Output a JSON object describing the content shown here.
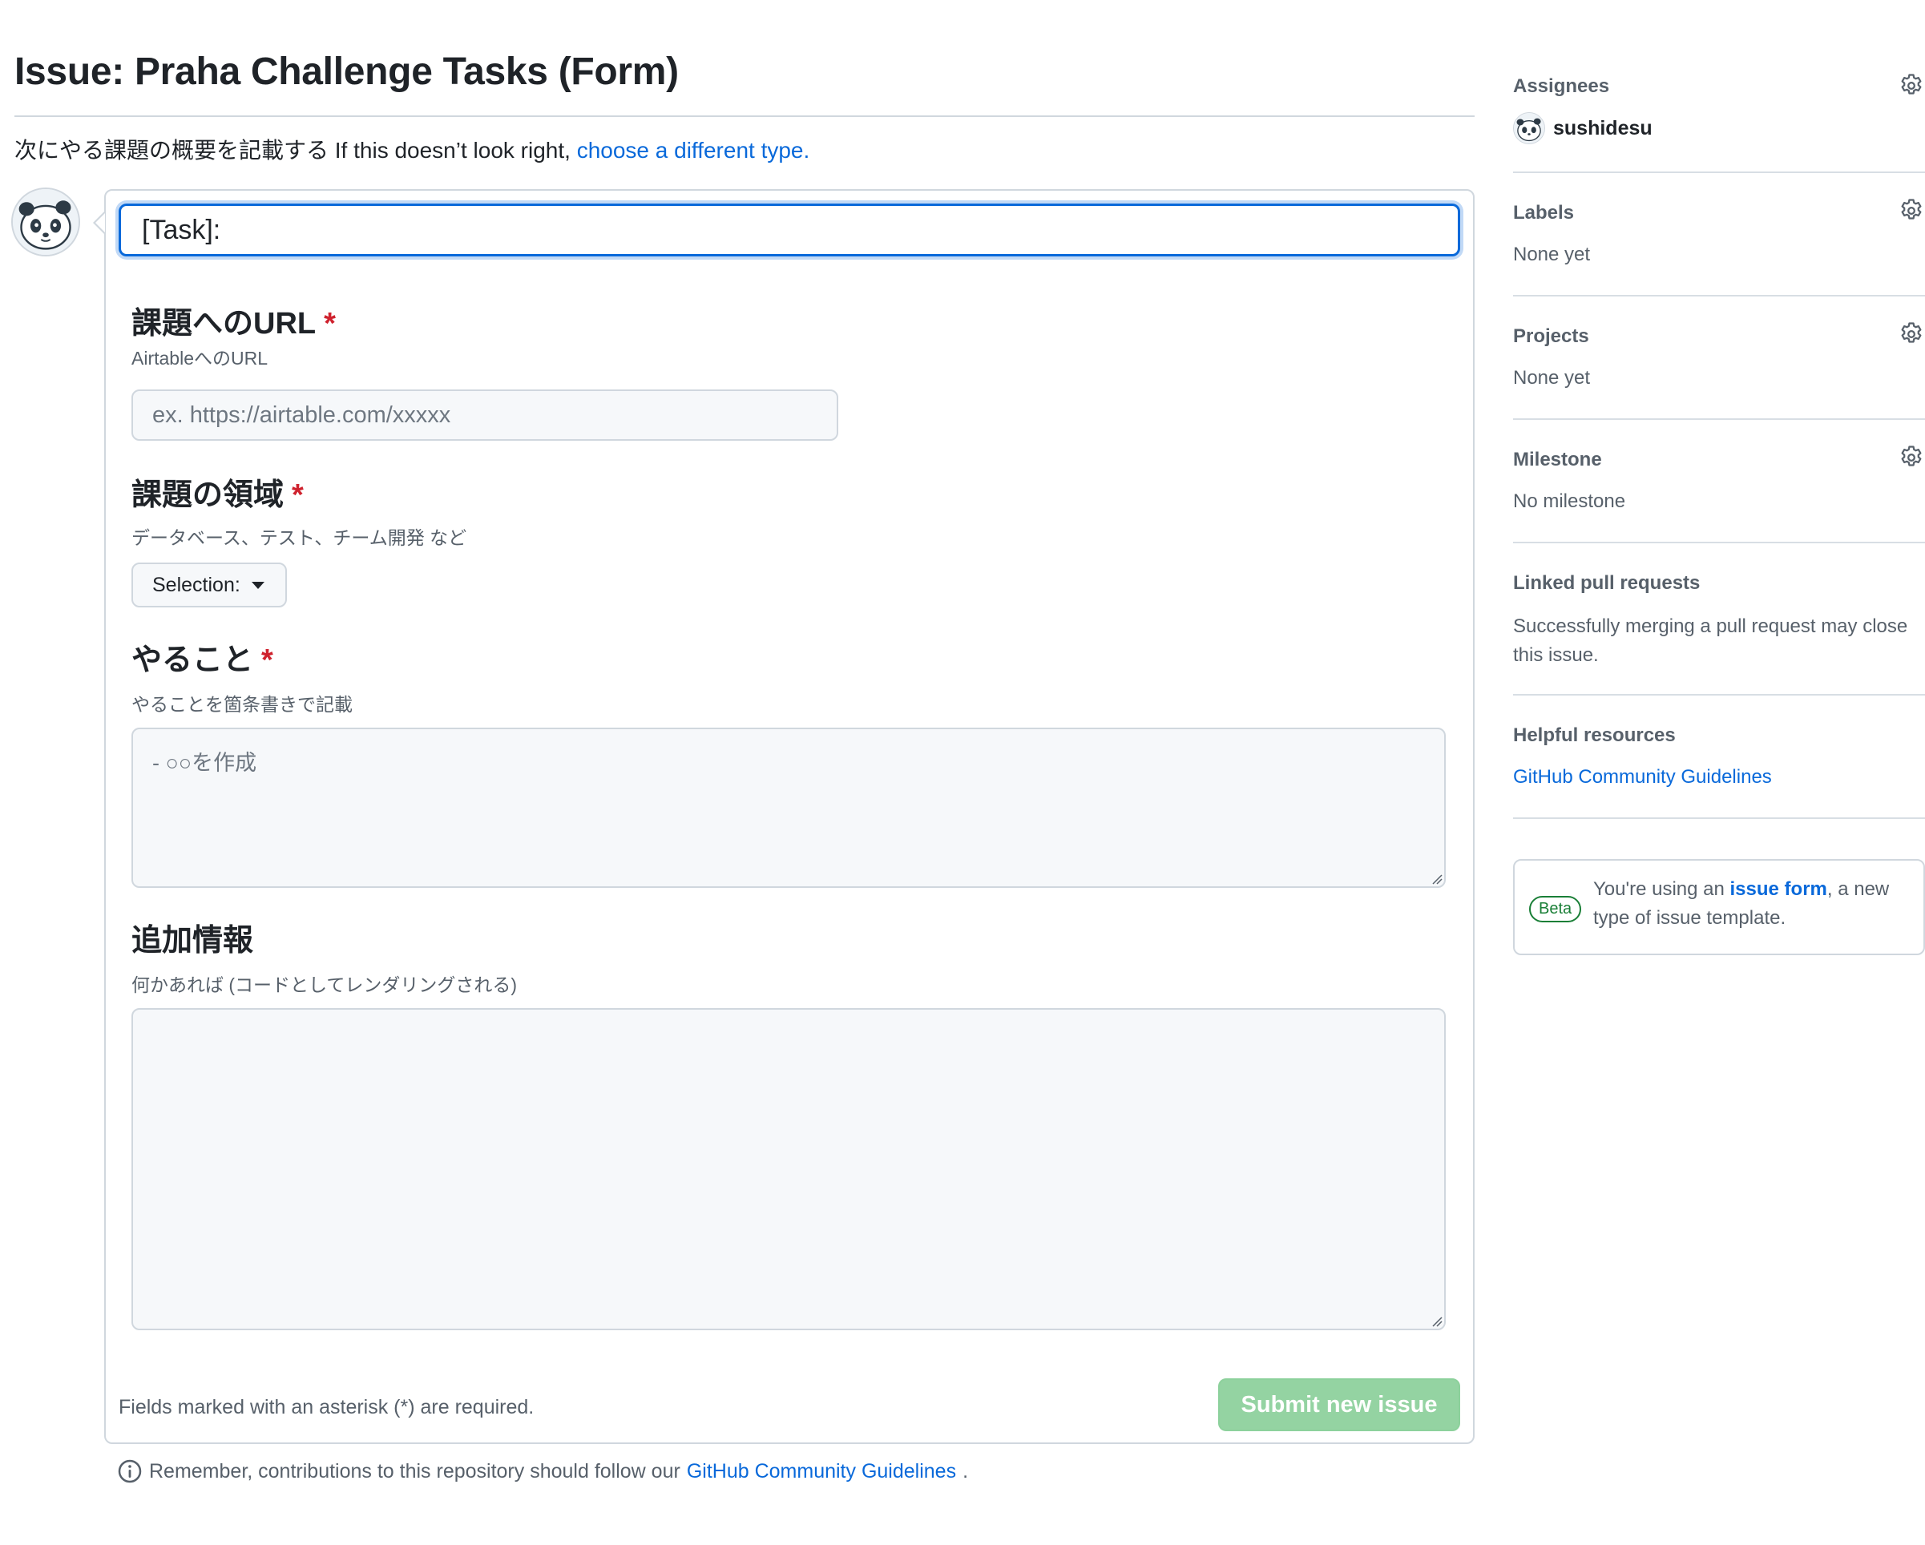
{
  "page": {
    "title": "Issue: Praha Challenge Tasks (Form)",
    "intro_text": "次にやる課題の概要を記載する If this doesn’t look right,",
    "intro_link": "choose a different type."
  },
  "form": {
    "title_value": "[Task]: ",
    "fields": [
      {
        "label": "課題へのURL",
        "required_mark": "*",
        "description": "AirtableへのURL",
        "placeholder": "ex. https://airtable.com/xxxxx"
      },
      {
        "label": "課題の領域",
        "required_mark": "*",
        "description": "データベース、テスト、チーム開発 など",
        "select_label": "Selection:"
      },
      {
        "label": "やること",
        "required_mark": "*",
        "description": "やることを箇条書きで記載",
        "placeholder": "- ○○を作成"
      },
      {
        "label": "追加情報",
        "description": "何かあれば (コードとしてレンダリングされる)",
        "placeholder": ""
      }
    ],
    "footer_note": "Fields marked with an asterisk (*) are required.",
    "submit_label": "Submit new issue"
  },
  "remember": {
    "text": "Remember, contributions to this repository should follow our",
    "link": "GitHub Community Guidelines",
    "suffix": "."
  },
  "sidebar": {
    "assignees": {
      "heading": "Assignees",
      "user": "sushidesu"
    },
    "labels": {
      "heading": "Labels",
      "value": "None yet"
    },
    "projects": {
      "heading": "Projects",
      "value": "None yet"
    },
    "milestone": {
      "heading": "Milestone",
      "value": "No milestone"
    },
    "linked_prs": {
      "heading": "Linked pull requests",
      "value": "Successfully merging a pull request may close this issue."
    },
    "resources": {
      "heading": "Helpful resources",
      "link": "GitHub Community Guidelines"
    },
    "beta": {
      "badge": "Beta",
      "text_before": "You're using an",
      "link": "issue form",
      "text_after": ", a new type of issue template."
    }
  },
  "icons": [
    "gear-icon",
    "info-icon",
    "avatar",
    "caret-down-icon",
    "resize-grip-icon"
  ],
  "colors": {
    "link": "#0969da",
    "required": "#cf222e",
    "submit_bg": "#94d3a2",
    "beta": "#1a7f37",
    "focus": "#0969da"
  }
}
